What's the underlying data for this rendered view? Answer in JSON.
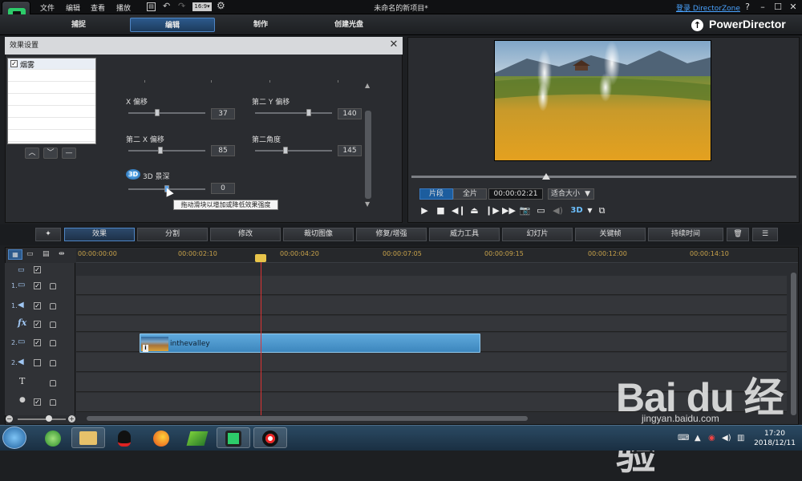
{
  "menu": {
    "file": "文件",
    "edit": "编辑",
    "view": "查看",
    "play": "播放"
  },
  "window": {
    "title": "未命名的新项目*",
    "login": "登录 DirectorZone",
    "help": "?",
    "minimize": "–",
    "maximize": "☐",
    "close": "✕"
  },
  "nav": {
    "tabs": [
      "捕捉",
      "编辑",
      "制作",
      "创建光盘"
    ],
    "active": "编辑",
    "brand": "PowerDirector"
  },
  "effect_panel": {
    "title": "效果设置",
    "list": [
      {
        "name": "烟雾",
        "checked": true
      }
    ],
    "params": {
      "x_offset": {
        "label": "X 偏移",
        "value": "37",
        "level": 0.37
      },
      "y2_offset": {
        "label": "第二 Y 偏移",
        "value": "140",
        "level": 0.7
      },
      "x2_offset": {
        "label": "第二 X 偏移",
        "value": "85",
        "level": 0.42
      },
      "angle2": {
        "label": "第二角度",
        "value": "145",
        "level": 0.4
      },
      "depth3d": {
        "label": "3D 景深",
        "value": "0",
        "badge": "3D",
        "level": 0.5
      }
    },
    "tooltip": "拖动滑块以增加或降低效果强度"
  },
  "preview": {
    "clip_label": "片段",
    "full_label": "全片",
    "timecode": "00:00:02:21",
    "fit": "适合大小",
    "badge3d": "3D",
    "progress": 0.35
  },
  "toolbar": {
    "buttons": [
      "效果",
      "分割",
      "修改",
      "裁切图像",
      "修复/增强",
      "威力工具",
      "幻灯片",
      "关键帧",
      "持续时间"
    ],
    "active": "效果"
  },
  "timeline": {
    "ruler": [
      "00:00:00:00",
      "00:00:02:10",
      "00:00:04:20",
      "00:00:07:05",
      "00:00:09:15",
      "00:00:12:00",
      "00:00:14:10"
    ],
    "tracks": [
      {
        "label": "1.",
        "icon": "video-icon"
      },
      {
        "label": "1.",
        "icon": "audio-icon"
      },
      {
        "label": "fx",
        "icon": "fx-icon"
      },
      {
        "label": "2.",
        "icon": "video-icon"
      },
      {
        "label": "2.",
        "icon": "audio-icon"
      },
      {
        "label": "T",
        "icon": "title-icon"
      },
      {
        "label": "🎤",
        "icon": "mic-icon"
      }
    ],
    "clip": {
      "name": "inthevalley"
    }
  },
  "taskbar": {
    "time": "17:20",
    "date": "2018/12/11"
  },
  "watermark": {
    "brand": "Bai du 经验",
    "url": "jingyan.baidu.com"
  }
}
